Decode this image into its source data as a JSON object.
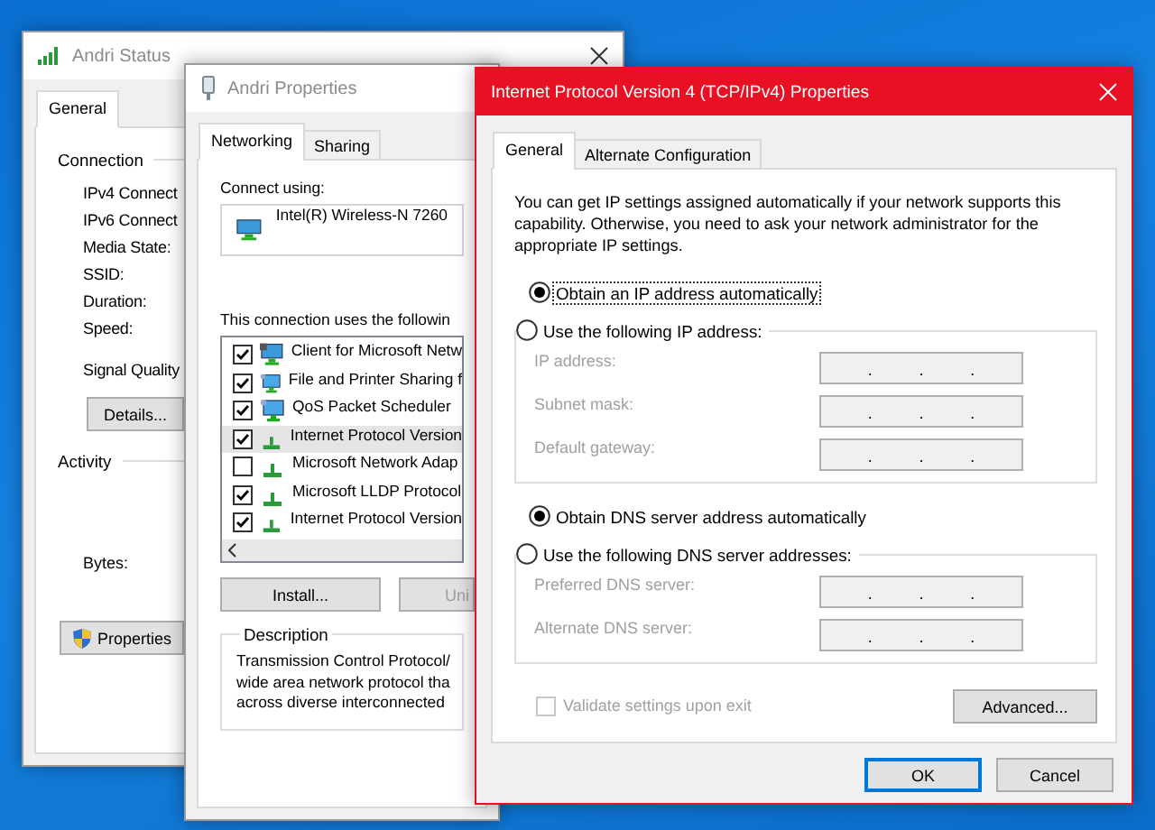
{
  "status_window": {
    "title": "Andri Status",
    "active": false,
    "tabs": [
      {
        "label": "General",
        "selected": true
      }
    ],
    "connection_heading": "Connection",
    "fields": [
      "IPv4 Connect",
      "IPv6 Connect",
      "Media State:",
      "SSID:",
      "Duration:",
      "Speed:"
    ],
    "signal_label": "Signal Quality",
    "details_button": "Details...",
    "activity_heading": "Activity",
    "bytes_label": "Bytes:",
    "properties_button": "Properties"
  },
  "properties_window": {
    "title": "Andri Properties",
    "active": false,
    "tabs": [
      {
        "label": "Networking",
        "selected": true
      },
      {
        "label": "Sharing",
        "selected": false
      }
    ],
    "connect_using_label": "Connect using:",
    "adapter": "Intel(R) Wireless-N 7260",
    "components_label": "This connection uses the followin",
    "components": [
      {
        "label": "Client for Microsoft Netw",
        "kind": "client",
        "checked": true,
        "selected": false
      },
      {
        "label": "File and Printer Sharing f",
        "kind": "service",
        "checked": true,
        "selected": false
      },
      {
        "label": "QoS Packet Scheduler",
        "kind": "service",
        "checked": true,
        "selected": false
      },
      {
        "label": "Internet Protocol Version",
        "kind": "protocol",
        "checked": true,
        "selected": true
      },
      {
        "label": "Microsoft Network Adap",
        "kind": "protocol",
        "checked": false,
        "selected": false
      },
      {
        "label": "Microsoft LLDP Protocol",
        "kind": "protocol",
        "checked": true,
        "selected": false
      },
      {
        "label": "Internet Protocol Version",
        "kind": "protocol",
        "checked": true,
        "selected": false
      }
    ],
    "buttons": [
      {
        "label": "Install...",
        "disabled": false
      },
      {
        "label": "Uni",
        "disabled": true
      }
    ],
    "description_heading": "Description",
    "description_lines": [
      "Transmission Control Protocol/",
      "wide area network protocol tha",
      "across diverse interconnected"
    ]
  },
  "ipv4_window": {
    "title": "Internet Protocol Version 4 (TCP/IPv4) Properties",
    "active": true,
    "tabs": [
      {
        "label": "General",
        "selected": true
      },
      {
        "label": "Alternate Configuration",
        "selected": false
      }
    ],
    "intro": "You can get IP settings assigned automatically if your network supports this capability. Otherwise, you need to ask your network administrator for the appropriate IP settings.",
    "ip_options": [
      {
        "label": "Obtain an IP address automatically",
        "selected": true,
        "focused": true
      },
      {
        "label": "Use the following IP address:",
        "selected": false,
        "focused": false
      }
    ],
    "ip_fields": [
      {
        "label": "IP address:",
        "disabled": true,
        "separators": [
          ".",
          ".",
          "."
        ]
      },
      {
        "label": "Subnet mask:",
        "disabled": true,
        "separators": [
          ".",
          ".",
          "."
        ]
      },
      {
        "label": "Default gateway:",
        "disabled": true,
        "separators": [
          ".",
          ".",
          "."
        ]
      }
    ],
    "dns_options": [
      {
        "label": "Obtain DNS server address automatically",
        "selected": true,
        "focused": false
      },
      {
        "label": "Use the following DNS server addresses:",
        "selected": false,
        "focused": false
      }
    ],
    "dns_fields": [
      {
        "label": "Preferred DNS server:",
        "disabled": true,
        "separators": [
          ".",
          ".",
          "."
        ]
      },
      {
        "label": "Alternate DNS server:",
        "disabled": true,
        "separators": [
          ".",
          ".",
          "."
        ]
      }
    ],
    "validate": {
      "label": "Validate settings upon exit",
      "checked": false,
      "disabled": true
    },
    "advanced_button": "Advanced...",
    "buttons": [
      {
        "label": "OK",
        "default": true
      },
      {
        "label": "Cancel",
        "default": false
      }
    ]
  }
}
